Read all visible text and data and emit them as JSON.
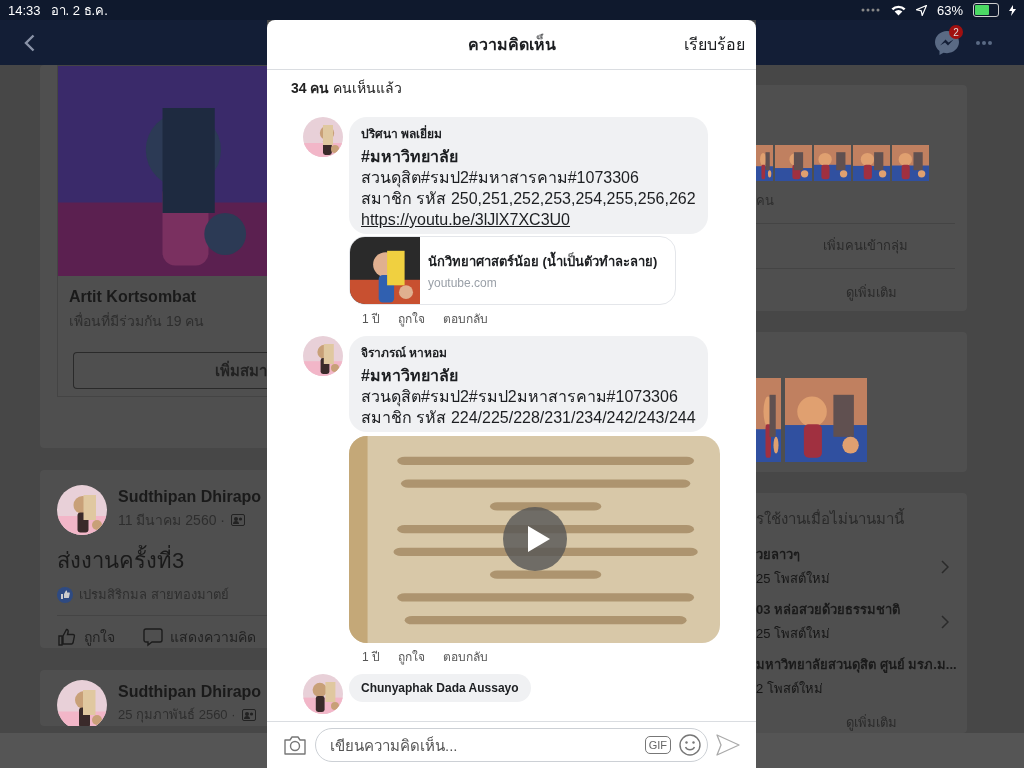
{
  "status_bar": {
    "time": "14:33",
    "date": "อา. 2 ธ.ค.",
    "battery": "63%"
  },
  "nav": {
    "messenger_badge": "2"
  },
  "left": {
    "profile_card": {
      "name": "Artit Kortsombat",
      "mutual": "เพื่อนที่มีร่วมกัน 19 คน",
      "button": "เพิ่มสมา"
    },
    "posts": [
      {
        "author": "Sudthipan Dhirapo",
        "date": "11 มีนาคม 2560 ·",
        "text": "ส่งงานครั้งที่3",
        "liker": "เปรมสิริกมล สายทองมาตย์",
        "actions": [
          "ถูกใจ",
          "แสดงความคิด"
        ]
      },
      {
        "author": "Sudthipan Dhirapo",
        "date": "25 กุมภาพันธ์ 2560 ·"
      }
    ]
  },
  "right": {
    "members_card": {
      "caption": "คน",
      "add_button": "เพิ่มคนเข้ากลุ่ม",
      "more": "ดูเพิ่มเติม"
    },
    "recent_card": {
      "heading": "รใช้งานเมื่อไม่นานมานี้",
      "items": [
        {
          "title": "วยลาวๆ",
          "sub": "25 โพสต์ใหม่"
        },
        {
          "title": "03 หล่อสวยด้วยธรรมชาติ",
          "sub": "25 โพสต์ใหม่"
        },
        {
          "title": "มหาวิทยาลัยสวนดุสิต ศูนย์ มรภ.ม...",
          "sub": "2 โพสต์ใหม่"
        }
      ],
      "more": "ดูเพิ่มเติม"
    }
  },
  "modal": {
    "title": "ความคิดเห็น",
    "done": "เรียบร้อย",
    "seen": "**34 คน** คนเห็นแล้ว",
    "comments": [
      {
        "author": "ปริศนา พลเยี่ยม",
        "hashtag": "#มหาวิทยาลัย",
        "lines": [
          "สวนดุสิต#รมป2#มหาสารคาม#1073306",
          "สมาชิก รหัส 250,251,252,253,254,255,256,262"
        ],
        "link": "https://youtu.be/3lJlX7XC3U0",
        "attachment": {
          "kind": "link_preview",
          "title": "นักวิทยาศาสตร์น้อย (น้ำเป็นตัวทำละลาย)",
          "domain": "youtube.com"
        },
        "time": "1 ปี",
        "like": "ถูกใจ",
        "reply": "ตอบกลับ"
      },
      {
        "author": "จิราภรณ์ หาหอม",
        "hashtag": "#มหาวิทยาลัย",
        "lines": [
          "สวนดุสิต#รมป2#รมป2มหาสารคาม#1073306",
          "สมาชิก รหัส 224/225/228/231/234/242/243/244"
        ],
        "attachment": {
          "kind": "video"
        },
        "time": "1 ปี",
        "like": "ถูกใจ",
        "reply": "ตอบกลับ"
      },
      {
        "author": "Chunyaphak Dada Aussayo"
      }
    ],
    "input": {
      "placeholder": "เขียนความคิดเห็น...",
      "gif": "GIF"
    }
  }
}
